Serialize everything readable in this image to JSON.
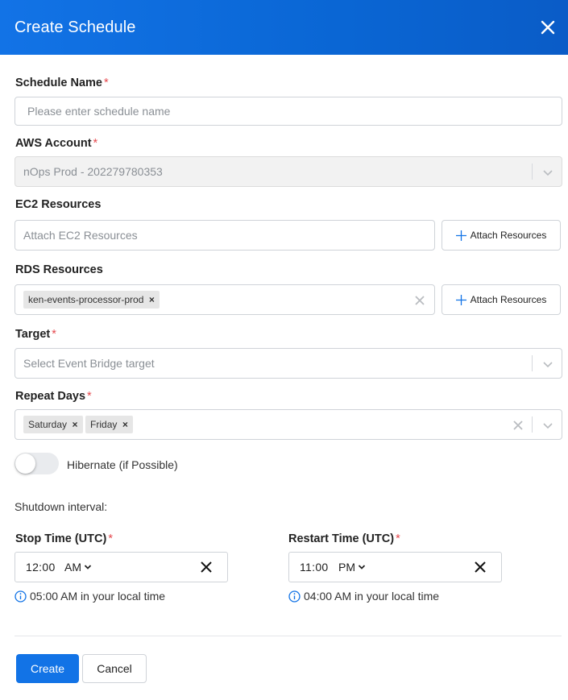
{
  "dialog": {
    "title": "Create Schedule",
    "close_icon": "close-icon",
    "header_color": "#1273e6"
  },
  "schedule_name": {
    "label": "Schedule Name",
    "required_mark": "*",
    "placeholder": "Please enter schedule name",
    "value": ""
  },
  "aws_account": {
    "label": "AWS Account",
    "required_mark": "*",
    "value": "nOps Prod - 202279780353",
    "disabled": true
  },
  "ec2_resources": {
    "label": "EC2 Resources",
    "placeholder": "Attach EC2 Resources",
    "attach_label": "Attach Resources"
  },
  "rds_resources": {
    "label": "RDS Resources",
    "chips": [
      "ken-events-processor-prod"
    ],
    "attach_label": "Attach Resources"
  },
  "target": {
    "label": "Target",
    "required_mark": "*",
    "placeholder": "Select Event Bridge target"
  },
  "repeat_days": {
    "label": "Repeat Days",
    "required_mark": "*",
    "chips": [
      "Saturday",
      "Friday"
    ]
  },
  "hibernate": {
    "label": "Hibernate (if Possible)",
    "enabled": false
  },
  "shutdown_interval_label": "Shutdown interval:",
  "stop_time": {
    "label": "Stop Time (UTC)",
    "required_mark": "*",
    "time": "12:00",
    "ampm": "AM",
    "hint": "05:00 AM in your local time"
  },
  "restart_time": {
    "label": "Restart Time (UTC)",
    "required_mark": "*",
    "time": "11:00",
    "ampm": "PM",
    "hint": "04:00 AM in your local time"
  },
  "footer": {
    "create_label": "Create",
    "cancel_label": "Cancel",
    "primary_color": "#1273e6"
  }
}
